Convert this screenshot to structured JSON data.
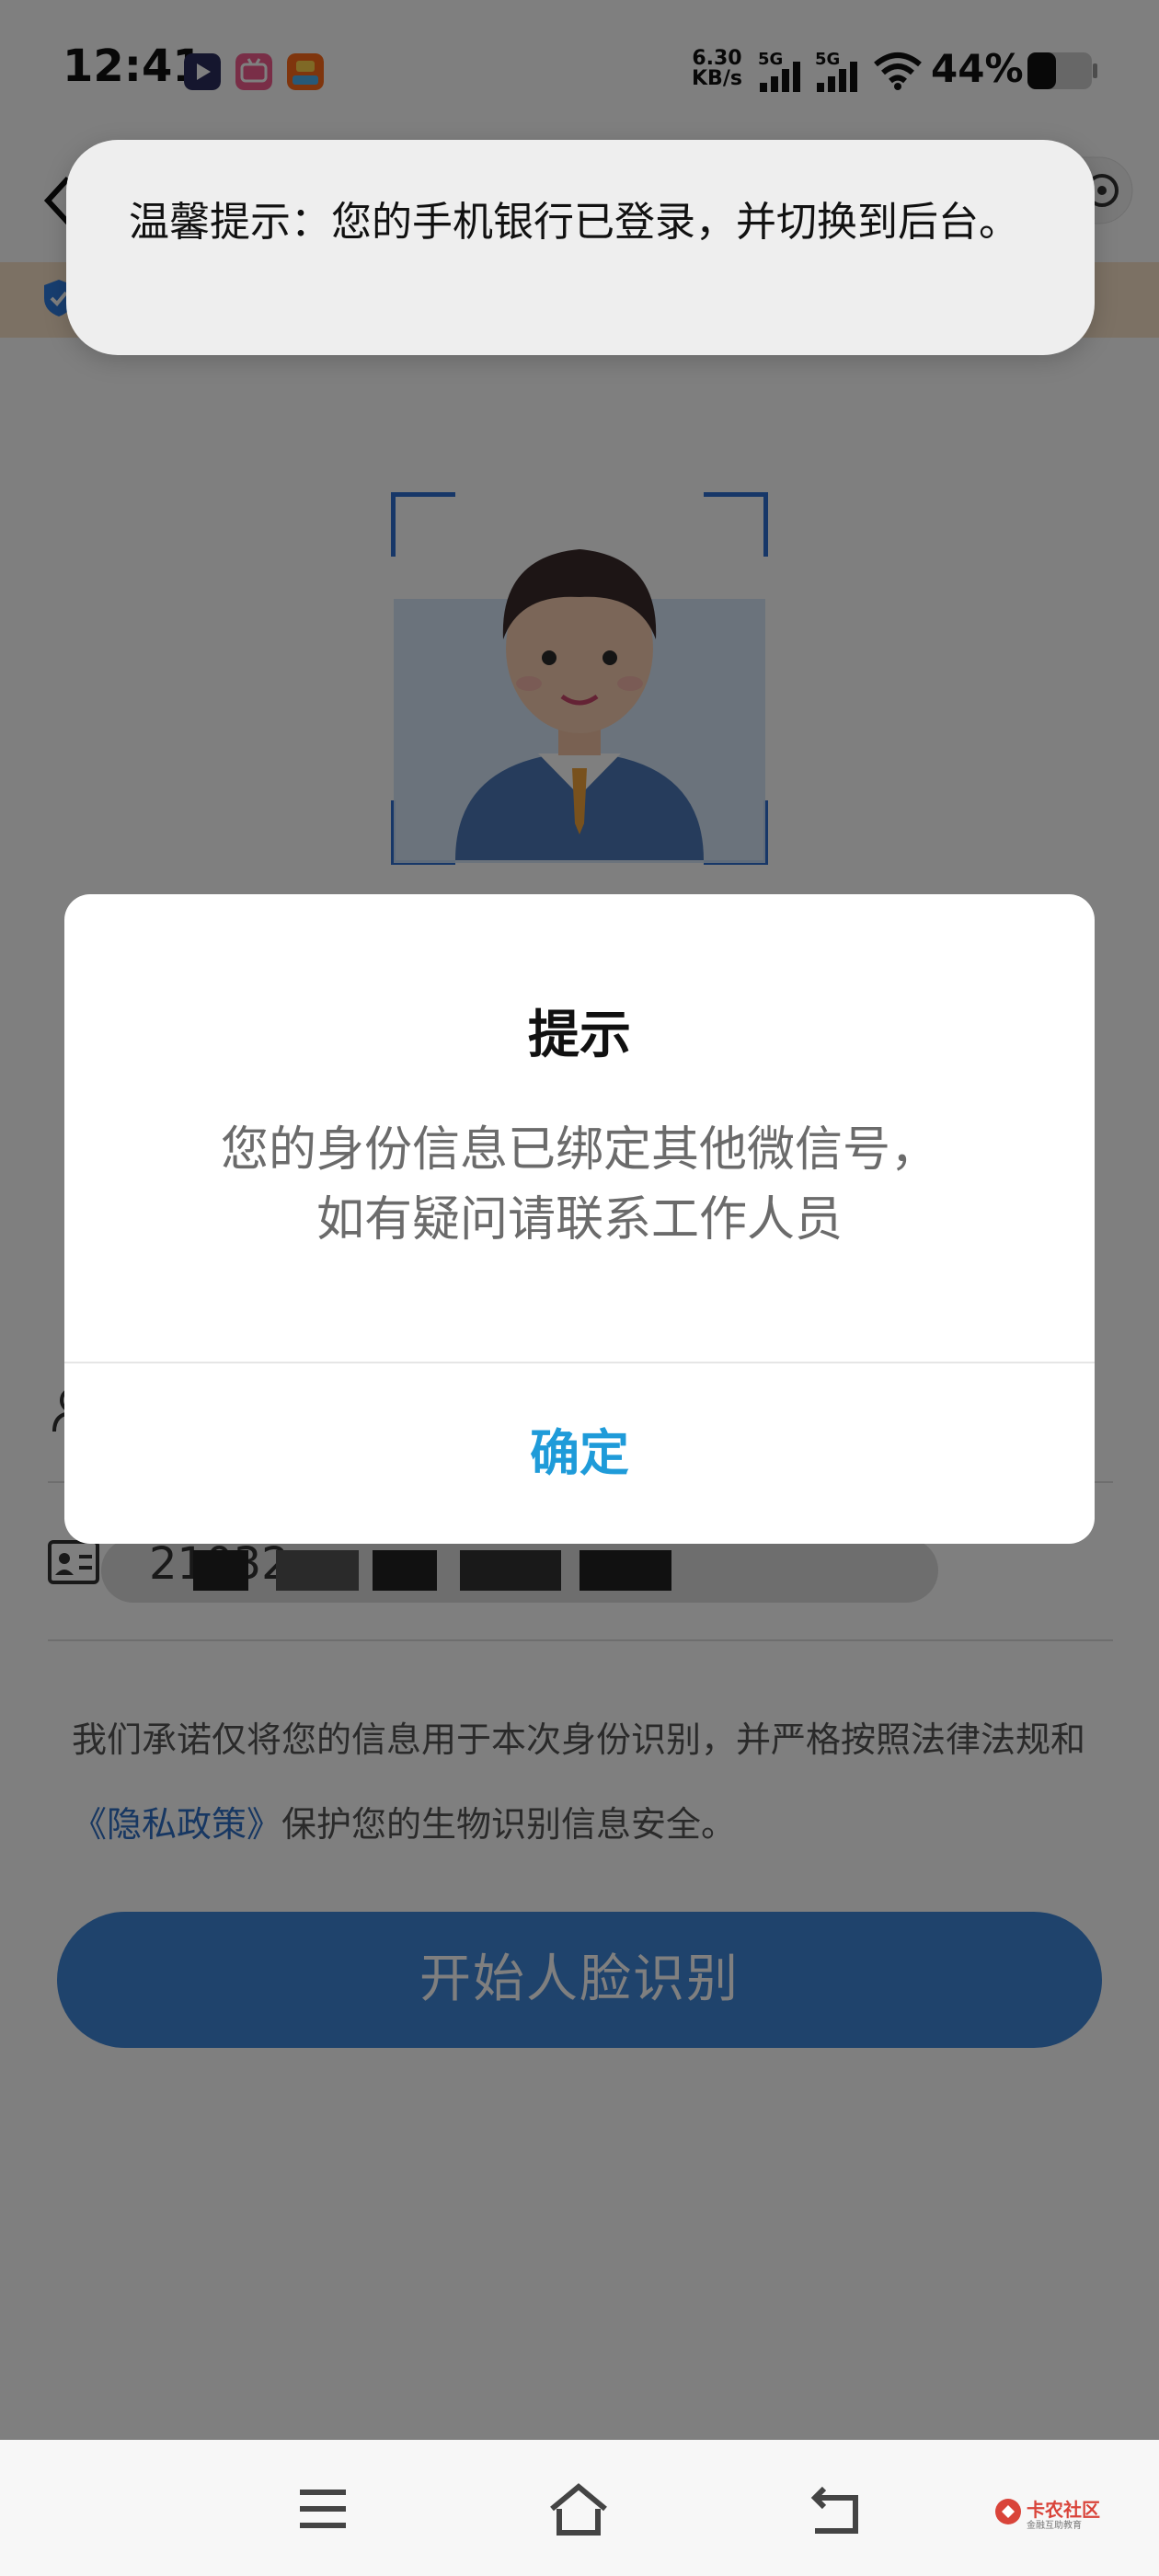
{
  "status_bar": {
    "time": "12:41",
    "net_speed_value": "6.30",
    "net_speed_unit": "KB/s",
    "sim1_label": "5G",
    "sim2_label": "5G",
    "battery_percent": "44%"
  },
  "toast": {
    "text": "温馨提示：您的手机银行已登录，并切换到后台。"
  },
  "dialog": {
    "title": "提示",
    "message_line1": "您的身份信息已绑定其他微信号，",
    "message_line2": "如有疑问请联系工作人员",
    "confirm_label": "确定"
  },
  "form": {
    "id_prefix_visible": "21032"
  },
  "promise": {
    "text_before": "我们承诺仅将您的信息用于本次身份识别，并严格按照法律法规和",
    "privacy_link": "《隐私政策》",
    "text_after": "保护您的生物识别信息安全。"
  },
  "start_button": {
    "label": "开始人脸识别"
  },
  "watermark": {
    "title": "卡农社区",
    "subtitle": "金融互助教育"
  },
  "colors": {
    "primary_blue": "#3f86d9",
    "dialog_button": "#1f9bd9",
    "link": "#2f6fc4",
    "notice_strip": "#f9e3c8"
  }
}
